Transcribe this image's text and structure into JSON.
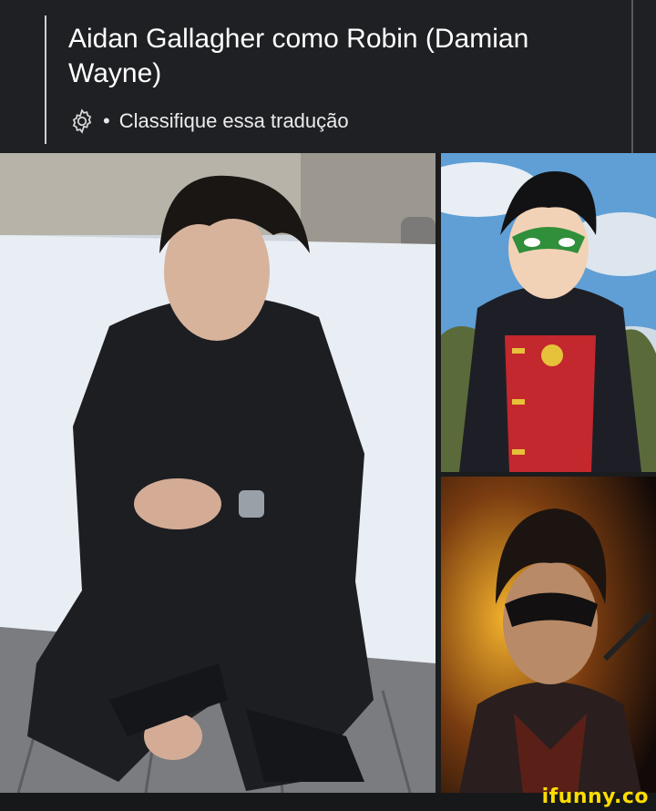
{
  "post": {
    "title": "Aidan Gallagher como Robin (Damian Wayne)",
    "rate_icon": "gear-icon",
    "separator": "•",
    "rate_translation": "Classifique essa tradução"
  },
  "images": {
    "main": "Photo of a young man in a black sweater crouching on a snowy terrace",
    "top_right": "Animated Robin (Damian Wayne) with green mask and red costume",
    "bottom_right": "Live-action style Robin in a dark mask against an orange glow"
  },
  "watermark": {
    "text": "ifunny.co",
    "color": "#ffdc00"
  }
}
